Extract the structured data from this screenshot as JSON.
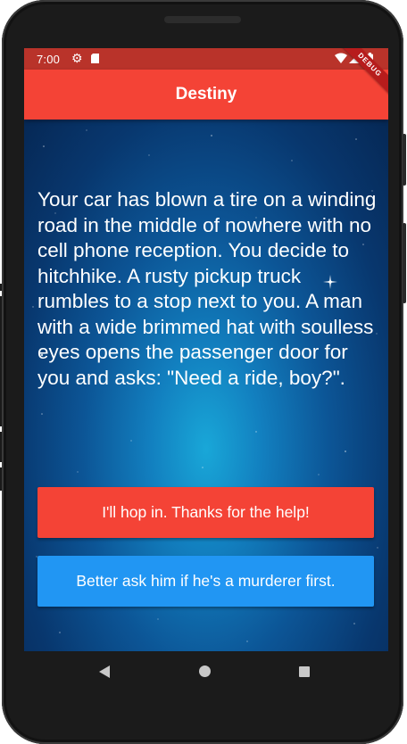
{
  "status_bar": {
    "time": "7:00",
    "icons": [
      "gear-icon",
      "sd-card-icon",
      "wifi-icon",
      "signal-icon",
      "battery-icon"
    ]
  },
  "debug_banner": "DEBUG",
  "app_bar": {
    "title": "Destiny"
  },
  "story": {
    "text": "Your car has blown a tire on a winding road in the middle of nowhere with no cell phone reception. You decide to hitchhike. A rusty pickup truck rumbles to a stop next to you. A man with a wide brimmed hat with soulless eyes opens the passenger door for you and asks: \"Need a ride, boy?\"."
  },
  "choices": [
    {
      "label": "I'll hop in. Thanks for the help!",
      "color": "#f44336"
    },
    {
      "label": "Better ask him if he's a murderer first.",
      "color": "#2196f3"
    }
  ],
  "nav_bar": {
    "icons": [
      "back-icon",
      "home-icon",
      "recents-icon"
    ]
  },
  "colors": {
    "primary": "#f44336",
    "status_bar": "#b9332a",
    "secondary_button": "#2196f3"
  }
}
